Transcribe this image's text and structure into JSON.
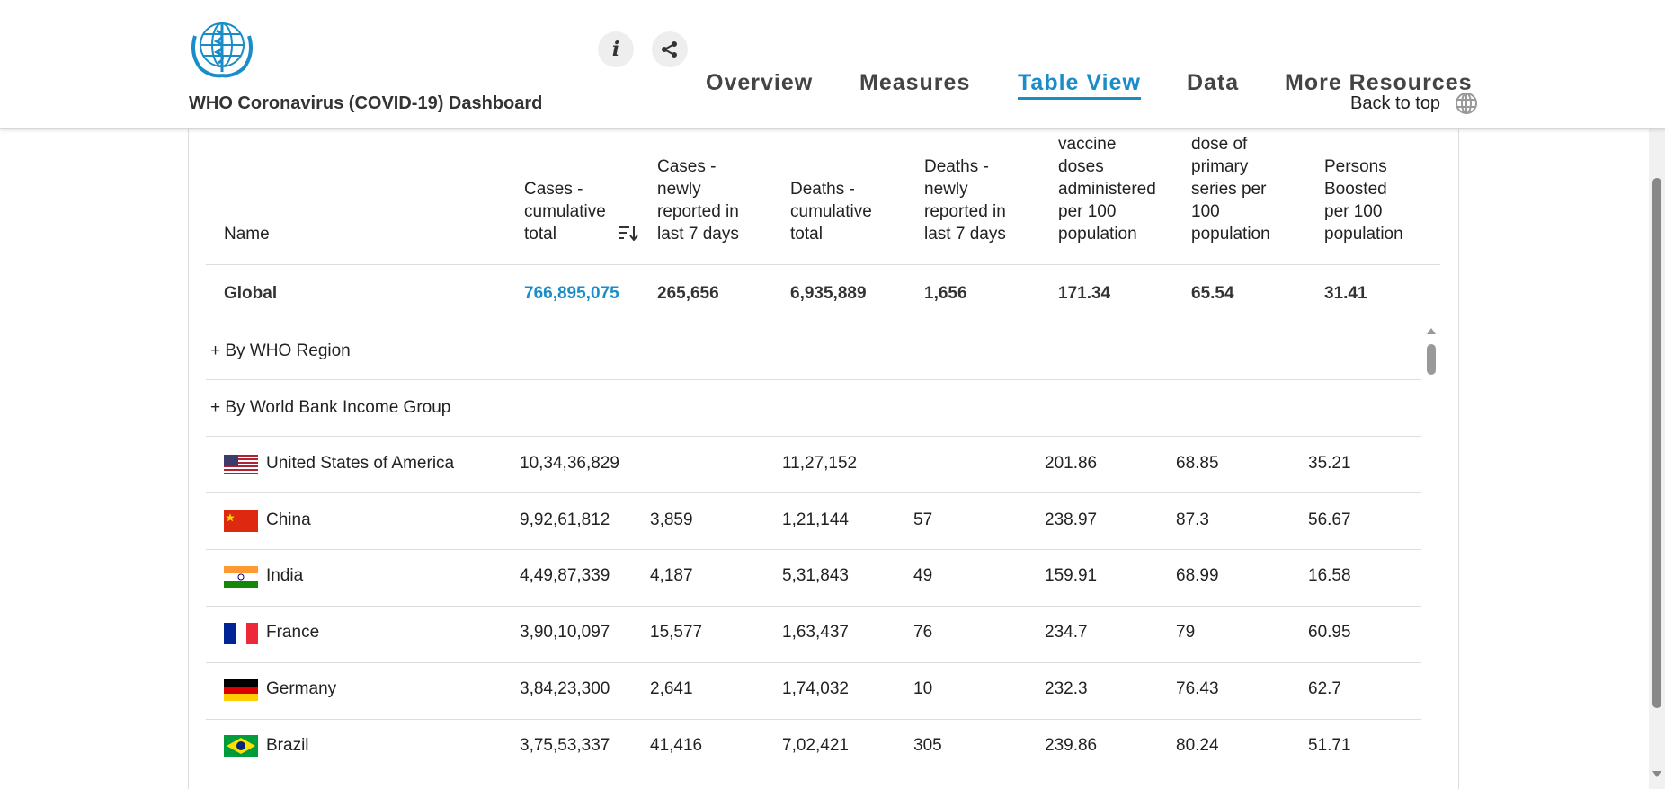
{
  "header": {
    "app_title": "WHO Coronavirus (COVID-19) Dashboard",
    "nav": [
      {
        "label": "Overview",
        "active": false
      },
      {
        "label": "Measures",
        "active": false
      },
      {
        "label": "Table View",
        "active": true
      },
      {
        "label": "Data",
        "active": false
      },
      {
        "label": "More Resources",
        "active": false
      }
    ],
    "info_icon": "i",
    "back_to_top": "Back to top",
    "accent_color": "#1a8cc8"
  },
  "table": {
    "columns": [
      {
        "line1": "Name"
      },
      {
        "line1": "Cases -",
        "line2": "cumulative",
        "line3": "total"
      },
      {
        "line1": "Cases -",
        "line2": "newly",
        "line3": "reported in",
        "line4": "last 7 days"
      },
      {
        "line1": "Deaths -",
        "line2": "cumulative",
        "line3": "total"
      },
      {
        "line1": "Deaths -",
        "line2": "newly",
        "line3": "reported in",
        "line4": "last 7 days"
      },
      {
        "line1": "vaccine",
        "line2": "doses",
        "line3": "administered",
        "line4": "per 100",
        "line5": "population"
      },
      {
        "line1": "dose of",
        "line2": "primary",
        "line3": "series per",
        "line4": "100",
        "line5": "population"
      },
      {
        "line1": "Persons",
        "line2": "Boosted",
        "line3": "per 100",
        "line4": "population"
      }
    ],
    "global": {
      "name": "Global",
      "cases_total": "766,895,075",
      "cases_7d": "265,656",
      "deaths_total": "6,935,889",
      "deaths_7d": "1,656",
      "vaccine_doses": "171.34",
      "primary_series": "65.54",
      "boosted": "31.41"
    },
    "groups": [
      {
        "label": "+ By WHO Region"
      },
      {
        "label": "+ By World Bank Income Group"
      }
    ],
    "rows": [
      {
        "name": "United States of America",
        "flag": "us-flag",
        "cases_total": "10,34,36,829",
        "cases_7d": "",
        "deaths_total": "11,27,152",
        "deaths_7d": "",
        "vaccine_doses": "201.86",
        "primary_series": "68.85",
        "boosted": "35.21"
      },
      {
        "name": "China",
        "flag": "china-flag",
        "cases_total": "9,92,61,812",
        "cases_7d": "3,859",
        "deaths_total": "1,21,144",
        "deaths_7d": "57",
        "vaccine_doses": "238.97",
        "primary_series": "87.3",
        "boosted": "56.67"
      },
      {
        "name": "India",
        "flag": "india-flag",
        "cases_total": "4,49,87,339",
        "cases_7d": "4,187",
        "deaths_total": "5,31,843",
        "deaths_7d": "49",
        "vaccine_doses": "159.91",
        "primary_series": "68.99",
        "boosted": "16.58"
      },
      {
        "name": "France",
        "flag": "france-flag",
        "cases_total": "3,90,10,097",
        "cases_7d": "15,577",
        "deaths_total": "1,63,437",
        "deaths_7d": "76",
        "vaccine_doses": "234.7",
        "primary_series": "79",
        "boosted": "60.95"
      },
      {
        "name": "Germany",
        "flag": "germany-flag",
        "cases_total": "3,84,23,300",
        "cases_7d": "2,641",
        "deaths_total": "1,74,032",
        "deaths_7d": "10",
        "vaccine_doses": "232.3",
        "primary_series": "76.43",
        "boosted": "62.7"
      },
      {
        "name": "Brazil",
        "flag": "brazil-flag",
        "cases_total": "3,75,53,337",
        "cases_7d": "41,416",
        "deaths_total": "7,02,421",
        "deaths_7d": "305",
        "vaccine_doses": "239.86",
        "primary_series": "80.24",
        "boosted": "51.71"
      }
    ]
  }
}
